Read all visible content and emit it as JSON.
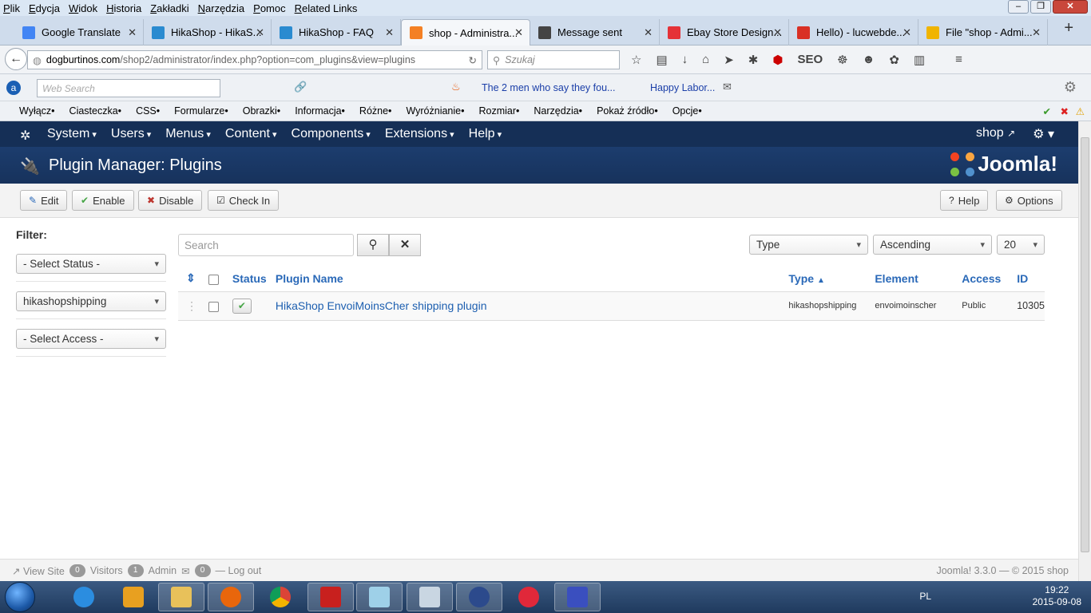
{
  "browser": {
    "menu": [
      "Plik",
      "Edycja",
      "Widok",
      "Historia",
      "Zakładki",
      "Narzędzia",
      "Pomoc",
      "Related Links"
    ],
    "tabs": [
      {
        "label": "Google Translate",
        "color": "#4285f4"
      },
      {
        "label": "HikaShop - HikaS...",
        "color": "#2a8bd0"
      },
      {
        "label": "HikaShop - FAQ",
        "color": "#2a8bd0"
      },
      {
        "label": "shop - Administra...",
        "color": "#f48024"
      },
      {
        "label": "Message sent",
        "color": "#444444"
      },
      {
        "label": "Ebay Store Design...",
        "color": "#e53238"
      },
      {
        "label": "Hello) - lucwebde...",
        "color": "#d93025"
      },
      {
        "label": "File \"shop - Admi...",
        "color": "#f0b400"
      }
    ],
    "url_domain": "dogburtinos.com",
    "url_path": "/shop2/administrator/index.php?option=com_plugins&view=plugins",
    "search_placeholder": "Szukaj",
    "web_search_placeholder": "Web Search",
    "bookmark_links": [
      "The 2 men who say they fou...",
      "Happy Labor..."
    ],
    "webdev_toolbar": [
      "Wyłącz•",
      "Ciasteczka•",
      "CSS•",
      "Formularze•",
      "Obrazki•",
      "Informacja•",
      "Różne•",
      "Wyróżnianie•",
      "Rozmiar•",
      "Narzędzia•",
      "Pokaż źródło•",
      "Opcje•"
    ]
  },
  "admin": {
    "nav": [
      "System",
      "Users",
      "Menus",
      "Content",
      "Components",
      "Extensions",
      "Help"
    ],
    "site_name": "shop",
    "page_title": "Plugin Manager: Plugins",
    "brand": "Joomla!",
    "toolbar": {
      "edit": "Edit",
      "enable": "Enable",
      "disable": "Disable",
      "checkin": "Check In",
      "help": "Help",
      "options": "Options"
    },
    "filter": {
      "label": "Filter:",
      "status": "- Select Status -",
      "folder": "hikashopshipping",
      "access": "- Select Access -"
    },
    "search_placeholder": "Search",
    "list_controls": {
      "type": "Type",
      "order": "Ascending",
      "limit": "20"
    },
    "columns": {
      "status": "Status",
      "name": "Plugin Name",
      "type": "Type",
      "element": "Element",
      "access": "Access",
      "id": "ID"
    },
    "rows": [
      {
        "name": "HikaShop EnvoiMoinsCher shipping plugin",
        "type": "hikashopshipping",
        "element": "envoimoinscher",
        "access": "Public",
        "id": "10305",
        "enabled": true
      }
    ],
    "footer": {
      "view_site": "View Site",
      "visitors_count": "0",
      "visitors": "Visitors",
      "admin_count": "1",
      "admin": "Admin",
      "mail_count": "0",
      "logout": "Log out",
      "copyright": "Joomla! 3.3.0 — © 2015 shop"
    }
  },
  "taskbar": {
    "lang": "PL",
    "time": "19:22",
    "date": "2015-09-08"
  }
}
